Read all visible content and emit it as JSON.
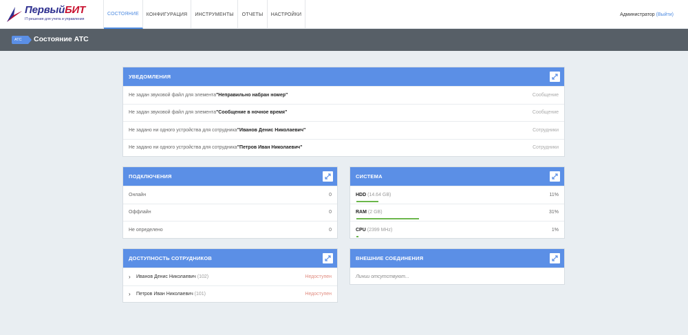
{
  "brand": {
    "name_main": "Первый",
    "name_accent": "БИТ",
    "tagline": "IT-решения для учета и управления"
  },
  "nav": [
    {
      "label": "СОСТОЯНИЕ",
      "active": true
    },
    {
      "label": "КОНФИГУРАЦИЯ",
      "active": false
    },
    {
      "label": "ИНСТРУМЕНТЫ",
      "active": false
    },
    {
      "label": "ОТЧЕТЫ",
      "active": false
    },
    {
      "label": "НАСТРОЙКИ",
      "active": false
    }
  ],
  "user": {
    "name": "Администратор",
    "logout": "(Выйти)"
  },
  "header": {
    "badge": "АТС",
    "title": "Состояние АТС"
  },
  "colors": {
    "accent": "#5b8fe6",
    "titlebar": "#575f67",
    "bar": "#6ab64a",
    "unavailable": "#e08a7e"
  },
  "notifications": {
    "title": "УВЕДОМЛЕНИЯ",
    "items": [
      {
        "prefix": "Не задан звуковой файл для элемента ",
        "name": "\"Неправильно набран номер\"",
        "type": "Сообщение"
      },
      {
        "prefix": "Не задан звуковой файл для элемента ",
        "name": "\"Сообщение в ночное время\"",
        "type": "Сообщение"
      },
      {
        "prefix": "Не задано ни одного устройства для сотрудника ",
        "name": "\"Иванов Денис Николаевич\"",
        "type": "Сотрудники"
      },
      {
        "prefix": "Не задано ни одного устройства для сотрудника ",
        "name": "\"Петров Иван Николаевич\"",
        "type": "Сотрудники"
      }
    ]
  },
  "connections": {
    "title": "ПОДКЛЮЧЕНИЯ",
    "items": [
      {
        "label": "Онлайн",
        "value": "0"
      },
      {
        "label": "Оффлайн",
        "value": "0"
      },
      {
        "label": "Не определено",
        "value": "0"
      }
    ]
  },
  "system": {
    "title": "СИСТЕМА",
    "items": [
      {
        "label": "HDD",
        "detail": "(14.64 GB)",
        "value": "11%",
        "percent": 11
      },
      {
        "label": "RAM",
        "detail": "(2 GB)",
        "value": "31%",
        "percent": 31
      },
      {
        "label": "CPU",
        "detail": "(2399 MHz)",
        "value": "1%",
        "percent": 1
      }
    ]
  },
  "availability": {
    "title": "ДОСТУПНОСТЬ СОТРУДНИКОВ",
    "items": [
      {
        "name": "Иванов Денис Николаевич",
        "ext": "(102)",
        "status": "Недоступен"
      },
      {
        "name": "Петров Иван Николаевич",
        "ext": "(101)",
        "status": "Недоступен"
      }
    ]
  },
  "external": {
    "title": "ВНЕШНИЕ СОЕДИНЕНИЯ",
    "empty": "Линии отсутствуют..."
  }
}
